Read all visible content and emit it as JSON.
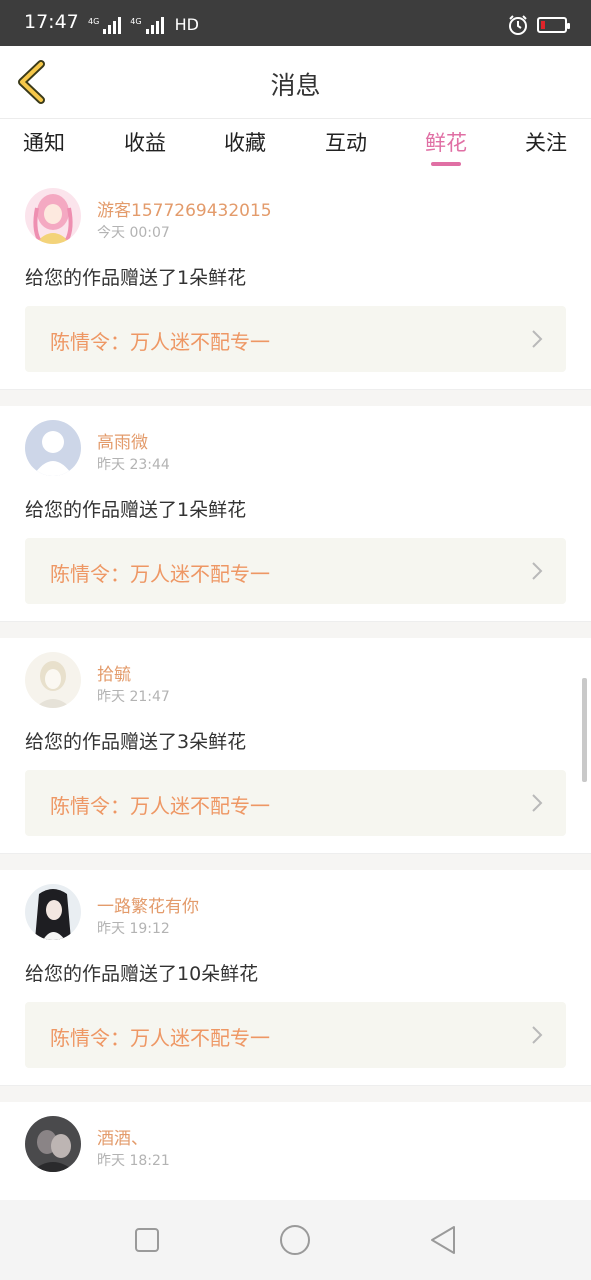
{
  "status_bar": {
    "time": "17:47",
    "network_1": "4G",
    "network_2": "4G",
    "hd": "HD"
  },
  "header": {
    "title": "消息"
  },
  "tabs": [
    {
      "label": "通知"
    },
    {
      "label": "收益"
    },
    {
      "label": "收藏"
    },
    {
      "label": "互动"
    },
    {
      "label": "鲜花",
      "active": true
    },
    {
      "label": "关注"
    }
  ],
  "colors": {
    "accent": "#e06fa4",
    "username": "#e39b6b",
    "work_title": "#ee9764",
    "status_bar": "#3d3d3d"
  },
  "messages": [
    {
      "username": "游客1577269432015",
      "time": "今天 00:07",
      "text": "给您的作品赠送了1朵鲜花",
      "work": "陈情令：万人迷不配专一"
    },
    {
      "username": "高雨微",
      "time": "昨天 23:44",
      "text": "给您的作品赠送了1朵鲜花",
      "work": "陈情令：万人迷不配专一"
    },
    {
      "username": "拾毓",
      "time": "昨天 21:47",
      "text": "给您的作品赠送了3朵鲜花",
      "work": "陈情令：万人迷不配专一"
    },
    {
      "username": "一路繁花有你",
      "time": "昨天 19:12",
      "text": "给您的作品赠送了10朵鲜花",
      "work": "陈情令：万人迷不配专一"
    },
    {
      "username": "酒酒、",
      "time": "昨天 18:21"
    }
  ],
  "icons": {
    "back": "chevron-left-icon",
    "chevron": "chevron-right-icon",
    "alarm": "alarm-icon",
    "battery": "battery-icon",
    "nav_recent": "square-icon",
    "nav_home": "circle-icon",
    "nav_back": "triangle-back-icon"
  }
}
